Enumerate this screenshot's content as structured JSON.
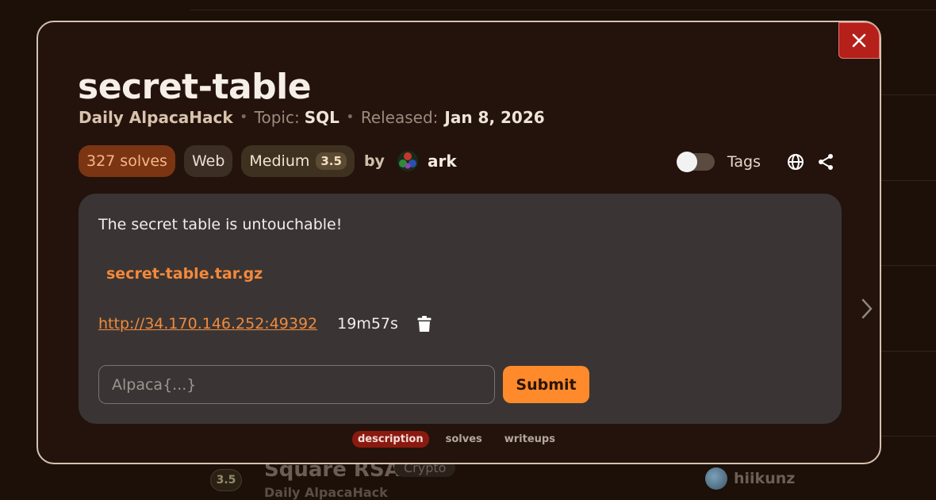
{
  "background": {
    "row": {
      "difficulty": "3.5",
      "title": "Square RSA",
      "category": "Crypto",
      "series": "Daily AlpacaHack",
      "author": "hiikunz"
    }
  },
  "modal": {
    "title": "secret-table",
    "meta": {
      "series": "Daily AlpacaHack",
      "topic_label": "Topic:",
      "topic": "SQL",
      "released_label": "Released:",
      "released": "Jan 8, 2026"
    },
    "badges": {
      "solves": "327 solves",
      "category": "Web",
      "difficulty_label": "Medium",
      "difficulty_value": "3.5",
      "by": "by",
      "author": "ark"
    },
    "tools": {
      "tags_label": "Tags",
      "tags_enabled": false
    },
    "panel": {
      "description": "The secret table is untouchable!",
      "file": "secret-table.tar.gz",
      "instance_url": "http://34.170.146.252:49392",
      "timer": "19m57s",
      "flag_placeholder": "Alpaca{...}",
      "submit_label": "Submit"
    },
    "tabs": [
      {
        "label": "description",
        "active": true
      },
      {
        "label": "solves",
        "active": false
      },
      {
        "label": "writeups",
        "active": false
      }
    ],
    "close_icon": "close-icon",
    "colors": {
      "accent": "#ff8a2b",
      "close": "#b5201a",
      "active_tab": "#8a1a10"
    }
  }
}
